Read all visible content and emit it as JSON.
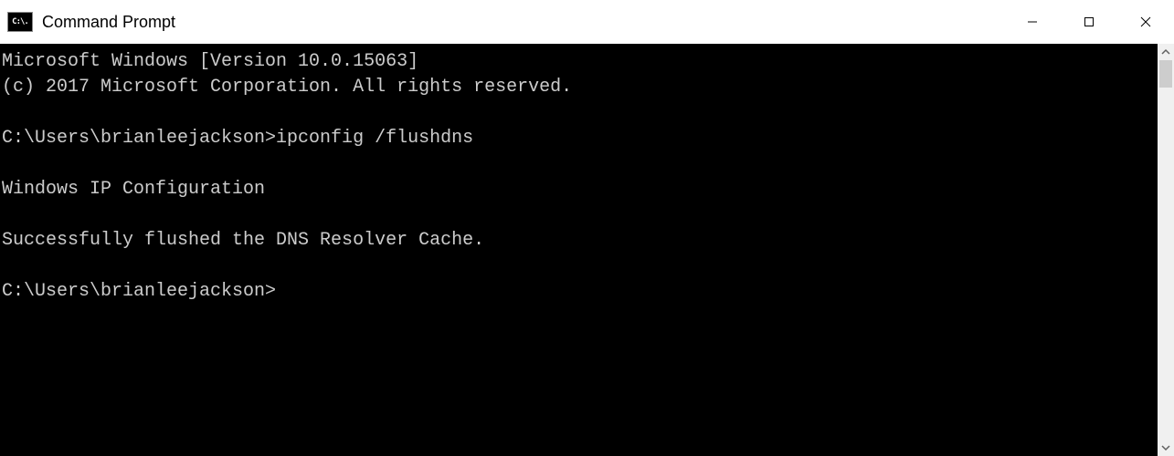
{
  "window": {
    "title": "Command Prompt",
    "icon_label": "C:\\."
  },
  "terminal": {
    "lines": [
      "Microsoft Windows [Version 10.0.15063]",
      "(c) 2017 Microsoft Corporation. All rights reserved.",
      "",
      "C:\\Users\\brianleejackson>ipconfig /flushdns",
      "",
      "Windows IP Configuration",
      "",
      "Successfully flushed the DNS Resolver Cache.",
      "",
      "C:\\Users\\brianleejackson>"
    ]
  }
}
